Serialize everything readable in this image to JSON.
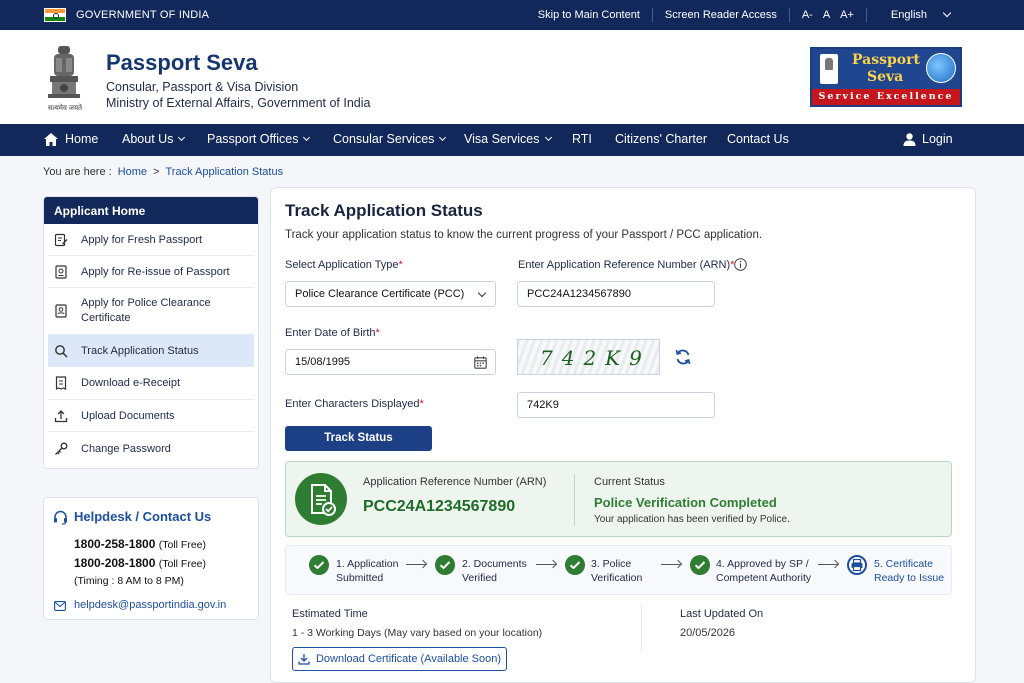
{
  "topbar": {
    "gov_text": "GOVERNMENT OF INDIA",
    "skip_link": "Skip to Main Content",
    "screen_reader": "Screen Reader Access",
    "font_smaller": "A-",
    "font_normal": "A",
    "font_larger": "A+",
    "language": "English"
  },
  "header": {
    "emblem_caption": "सत्यमेव जयते",
    "title": "Passport Seva",
    "subtitle1": "Consular, Passport & Visa Division",
    "subtitle2": "Ministry of External Affairs, Government of India",
    "logo_line1": "Passport",
    "logo_line2": "Seva",
    "logo_tagline": "Service Excellence"
  },
  "nav": {
    "home": "Home",
    "about": "About Us",
    "offices": "Passport Offices",
    "consular": "Consular Services",
    "visa": "Visa Services",
    "rti": "RTI",
    "charter": "Citizens' Charter",
    "contact": "Contact Us",
    "login": "Login"
  },
  "breadcrumb": {
    "prefix": "You are here :",
    "home": "Home",
    "sep": ">",
    "current": "Track Application Status"
  },
  "sidebar": {
    "title": "Applicant Home",
    "items": [
      {
        "label": "Apply for Fresh Passport"
      },
      {
        "label": "Apply for Re-issue of Passport"
      },
      {
        "label": "Apply for Police Clearance Certificate"
      },
      {
        "label": "Track Application Status"
      },
      {
        "label": "Download e-Receipt"
      },
      {
        "label": "Upload Documents"
      },
      {
        "label": "Change Password"
      }
    ]
  },
  "helpdesk": {
    "title": "Helpdesk / Contact Us",
    "phone1": "1800-258-1800",
    "phone1_note": "(Toll Free)",
    "phone2": "1800-208-1800",
    "phone2_note": "(Toll Free)",
    "timing": "(Timing : 8 AM to 8 PM)",
    "email": "helpdesk@passportindia.gov.in"
  },
  "main": {
    "title": "Track Application Status",
    "description": "Track your application status to know the current progress of your Passport / PCC application.",
    "app_type_label": "Select Application Type",
    "app_type_value": "Police Clearance Certificate (PCC)",
    "arn_label": "Enter Application Reference Number (ARN)",
    "arn_value": "PCC24A1234567890",
    "dob_label": "Enter Date of Birth",
    "dob_value": "15/08/1995",
    "captcha_text": "742K9",
    "captcha_label": "Enter Characters Displayed",
    "captcha_value": "742K9",
    "required_mark": "*",
    "track_button": "Track Status"
  },
  "status": {
    "arn_label": "Application Reference Number (ARN)",
    "arn_value": "PCC24A1234567890",
    "current_label": "Current Status",
    "current_value": "Police Verification Completed",
    "current_desc": "Your application has been verified by Police.",
    "completed_color": "#2e7d32",
    "current_color": "#1d4fa0"
  },
  "steps": [
    {
      "line1": "1. Application",
      "line2": "Submitted",
      "state": "done"
    },
    {
      "line1": "2. Documents",
      "line2": "Verified",
      "state": "done"
    },
    {
      "line1": "3. Police",
      "line2": "Verification",
      "state": "done"
    },
    {
      "line1": "4. Approved by SP /",
      "line2": "Competent Authority",
      "state": "done"
    },
    {
      "line1": "5. Certificate",
      "line2": "Ready to Issue",
      "state": "current"
    }
  ],
  "footer_info": {
    "est_label": "Estimated Time",
    "est_value": "1 - 3 Working Days (May vary based on your location)",
    "updated_label": "Last Updated On",
    "updated_value": "20/05/2026",
    "download_button": "Download Certificate (Available Soon)"
  }
}
